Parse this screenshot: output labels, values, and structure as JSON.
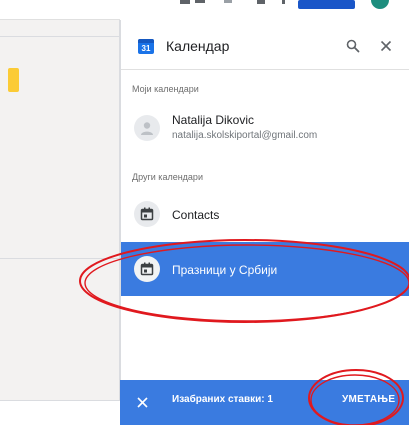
{
  "panel": {
    "title": "Календар",
    "badge": "31"
  },
  "sections": {
    "my_calendars_label": "Моји календари",
    "other_calendars_label": "Други календари"
  },
  "my_calendars": [
    {
      "name": "Natalija Dikovic",
      "email": "natalija.skolskiportal@gmail.com"
    }
  ],
  "other_calendars": [
    {
      "name": "Contacts",
      "selected": false
    },
    {
      "name": "Празници у Србији",
      "selected": true
    }
  ],
  "selection_bar": {
    "count_label": "Изабраних ставки: 1",
    "insert_label": "УМЕТАЊЕ"
  },
  "colors": {
    "accent": "#3a7be0",
    "annotation": "#e0191e",
    "doc_highlight": "#fbcb36"
  },
  "icons": {
    "header_logo": "calendar-31-icon",
    "search": "search-icon",
    "close": "close-icon",
    "avatar": "person-icon",
    "calendar_item": "calendar-icon",
    "dismiss": "close-icon"
  }
}
